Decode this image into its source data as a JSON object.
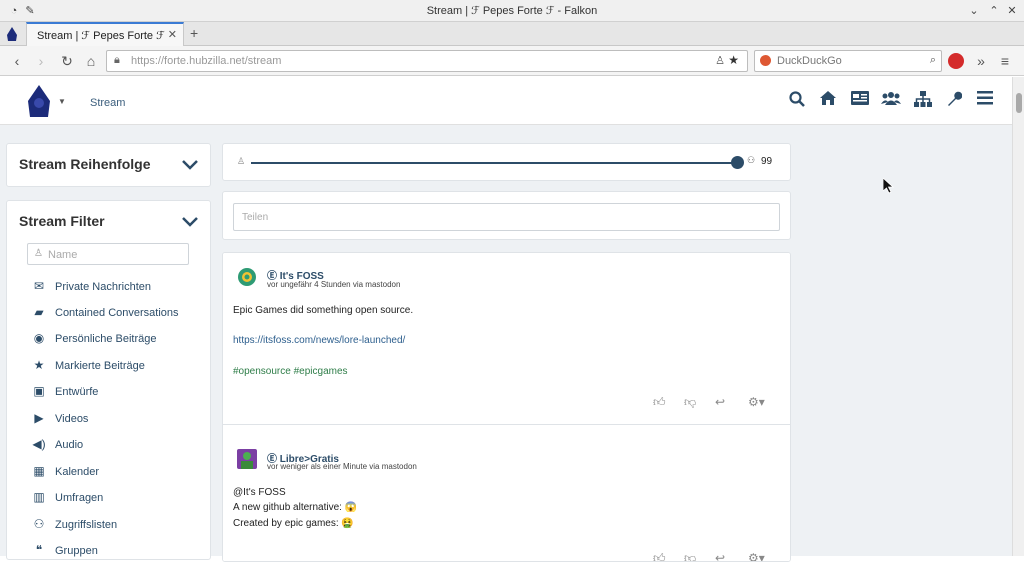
{
  "window": {
    "title": "Stream | ℱ Pepes Forte ℱ - Falkon"
  },
  "tabs": [
    {
      "label": "Stream | ℱ Pepes Forte ℱ"
    }
  ],
  "nav": {
    "url_host": "https://forte.hubzilla.net",
    "url_path": "/stream",
    "search_placeholder": "DuckDuckGo"
  },
  "app": {
    "header_link": "Stream"
  },
  "sidebar": {
    "order_title": "Stream Reihenfolge",
    "filter_title": "Stream Filter",
    "name_placeholder": "Name",
    "items": [
      {
        "label": "Private Nachrichten",
        "icon": "envelope-icon"
      },
      {
        "label": "Contained Conversations",
        "icon": "briefcase-icon"
      },
      {
        "label": "Persönliche Beiträge",
        "icon": "user-circle-icon"
      },
      {
        "label": "Markierte Beiträge",
        "icon": "star-icon"
      },
      {
        "label": "Entwürfe",
        "icon": "floppy-icon"
      },
      {
        "label": "Videos",
        "icon": "video-icon"
      },
      {
        "label": "Audio",
        "icon": "speaker-icon"
      },
      {
        "label": "Kalender",
        "icon": "calendar-icon"
      },
      {
        "label": "Umfragen",
        "icon": "bar-chart-icon"
      },
      {
        "label": "Zugriffslisten",
        "icon": "group-icon"
      },
      {
        "label": "Gruppen",
        "icon": "comments-icon"
      }
    ]
  },
  "slider": {
    "max_label": "99",
    "value": 99
  },
  "share": {
    "placeholder": "Teilen"
  },
  "posts": [
    {
      "author": "Ⓔ It's FOSS",
      "meta": "vor ungefähr 4 Stunden via mastodon",
      "lines": [
        "Epic Games did something open source."
      ],
      "link": "https://itsfoss.com/news/lore-launched/",
      "tags": "#opensource #epicgames"
    },
    {
      "author": "Ⓔ Libre>Gratis",
      "meta": "vor weniger als einer Minute via mastodon",
      "lines": [
        "@It's FOSS",
        "A new github alternative: 😱",
        "Created by epic games: 🤮"
      ]
    }
  ],
  "colors": {
    "accent": "#2c4c68",
    "link": "#2c5e8d",
    "tag": "#2e7d48"
  }
}
